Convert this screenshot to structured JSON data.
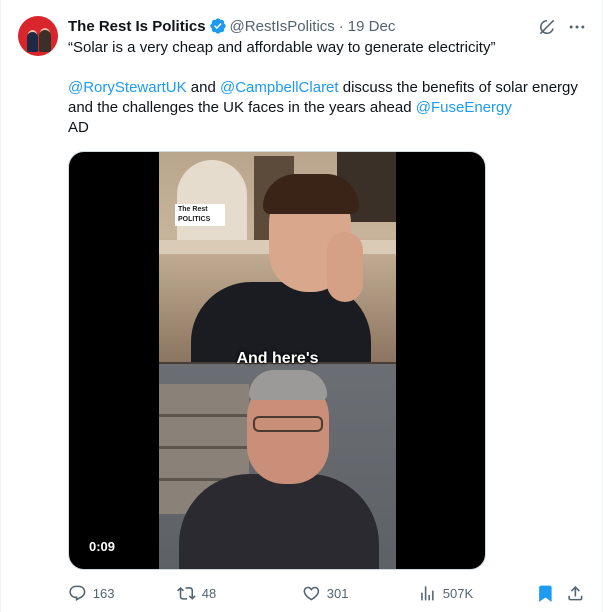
{
  "post": {
    "author_name": "The Rest Is Politics",
    "handle": "@RestIsPolitics",
    "separator": "·",
    "date": "19 Dec",
    "quote": "“Solar is a very cheap and affordable way to generate electricity”",
    "mention_rory": "@RoryStewartUK",
    "text_and": " and ",
    "mention_campbell": "@CampbellClaret",
    "text_body": " discuss the benefits of solar energy and the challenges the UK faces in the years ahead ",
    "mention_fuse": "@FuseEnergy",
    "ad_label": "AD",
    "avatar_logo_text": "The Rest Is POLITICS",
    "colors": {
      "mention": "#1d9bf0",
      "verified": "#1d9bf0",
      "bookmark_active": "#1d9bf0",
      "muted": "#536471"
    }
  },
  "video": {
    "logo_card": "The Rest POLITICS",
    "subtitle": "And here's",
    "timestamp": "0:09"
  },
  "actions": {
    "replies": "163",
    "reposts": "48",
    "likes": "301",
    "views": "507K",
    "icons": [
      "reply-icon",
      "repost-icon",
      "like-icon",
      "views-icon",
      "bookmark-icon",
      "share-icon"
    ]
  }
}
